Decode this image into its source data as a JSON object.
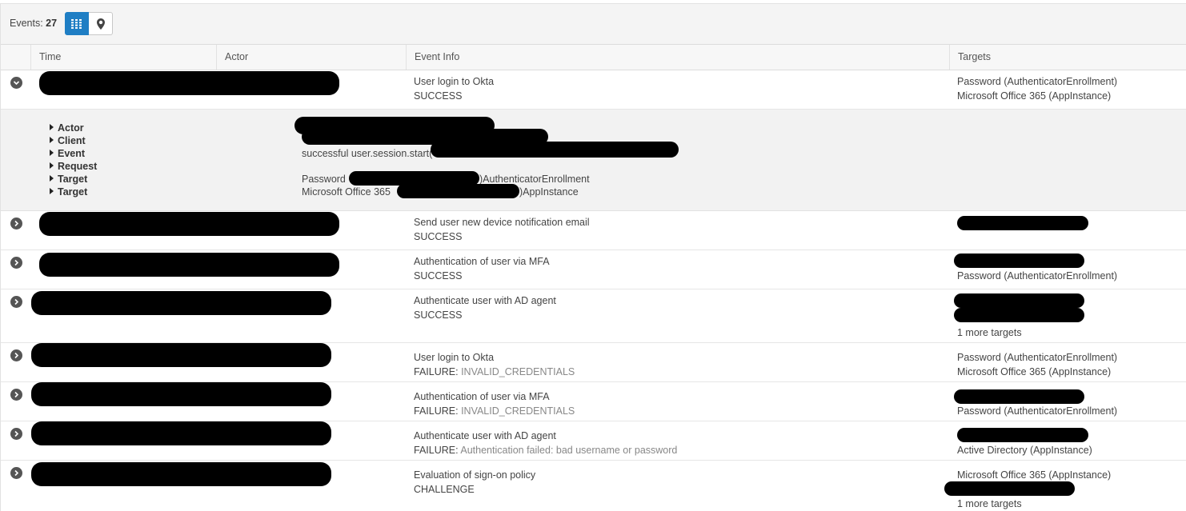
{
  "toolbar": {
    "events_label": "Events:",
    "events_count": "27",
    "grid_view_icon": "grid-icon",
    "map_view_icon": "map-pin-icon"
  },
  "columns": {
    "time": "Time",
    "actor": "Actor",
    "event_info": "Event Info",
    "targets": "Targets"
  },
  "rows": [
    {
      "event": "User login to Okta",
      "status": "SUCCESS",
      "reason": "",
      "targets": [
        "Password  (AuthenticatorEnrollment)",
        "Microsoft Office 365  (AppInstance)"
      ]
    },
    {
      "event": "Send user new device notification email",
      "status": "SUCCESS",
      "reason": "",
      "targets": []
    },
    {
      "event": "Authentication of user via MFA",
      "status": "SUCCESS",
      "reason": "",
      "targets": [
        "Password  (AuthenticatorEnrollment)"
      ]
    },
    {
      "event": "Authenticate user with AD agent",
      "status": "SUCCESS",
      "reason": "",
      "targets": [
        "1 more targets"
      ]
    },
    {
      "event": "User login to Okta",
      "status": "FAILURE:",
      "reason": "INVALID_CREDENTIALS",
      "targets": [
        "Password  (AuthenticatorEnrollment)",
        "Microsoft Office 365  (AppInstance)"
      ]
    },
    {
      "event": "Authentication of user via MFA",
      "status": "FAILURE:",
      "reason": "INVALID_CREDENTIALS",
      "targets": [
        "Password  (AuthenticatorEnrollment)"
      ]
    },
    {
      "event": "Authenticate user with AD agent",
      "status": "FAILURE:",
      "reason": "Authentication failed: bad username or password",
      "targets": [
        "Active Directory  (AppInstance)"
      ]
    },
    {
      "event": "Evaluation of sign-on policy",
      "status": "CHALLENGE",
      "reason": "",
      "targets": [
        "Microsoft Office 365  (AppInstance)",
        "1 more targets"
      ]
    }
  ],
  "detail": {
    "keys": [
      "Actor",
      "Client",
      "Event",
      "Request",
      "Target",
      "Target"
    ],
    "event_value": "successful user.session.start(",
    "target1_prefix": "Password",
    "target1_suffix": ")AuthenticatorEnrollment",
    "target2_prefix": "Microsoft Office 365",
    "target2_suffix": ")AppInstance"
  },
  "colors": {
    "accent": "#1f7ec4",
    "redaction": "#000000"
  }
}
